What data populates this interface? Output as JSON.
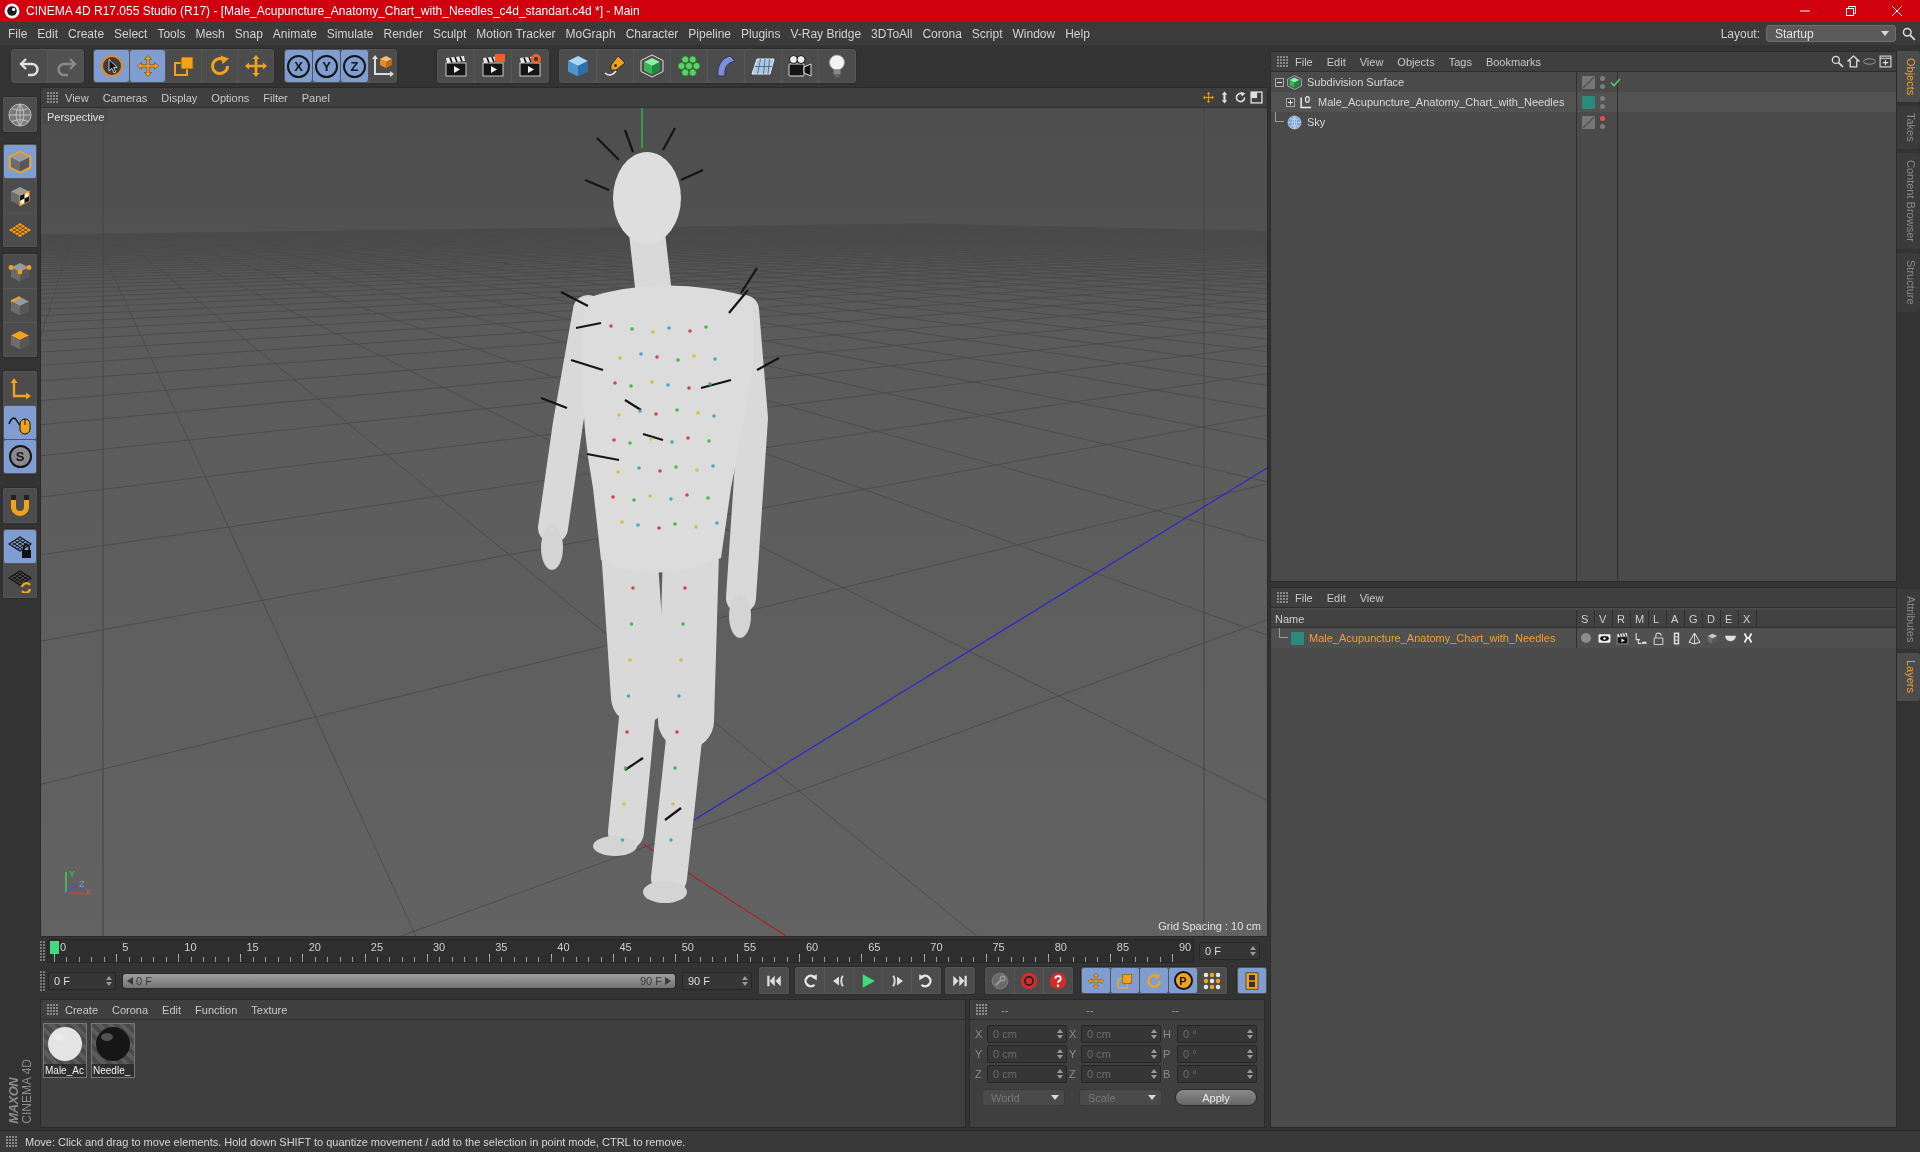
{
  "window": {
    "title": "CINEMA 4D R17.055 Studio (R17) - [Male_Acupuncture_Anatomy_Chart_with_Needles_c4d_standart.c4d *] - Main"
  },
  "menu_bar": [
    "File",
    "Edit",
    "Create",
    "Select",
    "Tools",
    "Mesh",
    "Snap",
    "Animate",
    "Simulate",
    "Render",
    "Sculpt",
    "Motion Tracker",
    "MoGraph",
    "Character",
    "Pipeline",
    "Plugins",
    "V-Ray Bridge",
    "3DToAll",
    "Corona",
    "Script",
    "Window",
    "Help"
  ],
  "layout": {
    "label": "Layout:",
    "value": "Startup"
  },
  "history": [
    {
      "disabled": false
    },
    {
      "disabled": true
    }
  ],
  "tools": [
    {
      "selected": true
    },
    {
      "selected": true
    },
    {
      "selected": false
    },
    {
      "selected": false
    },
    {
      "selected": false
    }
  ],
  "axis_locks": [
    {
      "label": "X",
      "selected": true
    },
    {
      "label": "Y",
      "selected": true
    },
    {
      "label": "Z",
      "selected": true
    }
  ],
  "modes": [
    [
      {
        "selected": false
      }
    ],
    [
      {
        "selected": true
      },
      {
        "selected": false
      },
      {
        "selected": false
      }
    ],
    [
      {
        "selected": false
      },
      {
        "selected": false
      },
      {
        "selected": false
      }
    ],
    [
      {
        "selected": false
      },
      {
        "selected": true
      },
      {
        "label": "S",
        "selected": true
      }
    ],
    [
      {
        "selected": false
      }
    ],
    [
      {
        "selected": true
      },
      {
        "selected": false
      }
    ]
  ],
  "logo": {
    "brand": "MAXON",
    "product": "CINEMA 4D"
  },
  "viewport": {
    "menu": [
      "View",
      "Cameras",
      "Display",
      "Options",
      "Filter",
      "Panel"
    ],
    "camera": "Perspective",
    "grid_spacing": "Grid Spacing : 10 cm",
    "gizmo_labels": [
      "Y",
      "Z",
      "X"
    ]
  },
  "timeline": {
    "ticks": [
      "0",
      "5",
      "10",
      "15",
      "20",
      "25",
      "30",
      "35",
      "40",
      "45",
      "50",
      "55",
      "60",
      "65",
      "70",
      "75",
      "80",
      "85",
      "90"
    ],
    "level": 0,
    "current_frame": "0 F"
  },
  "playback": {
    "start": "0 F",
    "range": {
      "start": "0 F",
      "end": "90 F",
      "level": 1
    },
    "end": "90 F",
    "key_filters": [
      {
        "selected": true
      },
      {
        "selected": true
      },
      {
        "selected": true
      },
      {
        "label": "P",
        "selected": true
      },
      {
        "selected": false
      }
    ],
    "timeline_view": {
      "selected": true
    }
  },
  "materials": {
    "menu": [
      "Create",
      "Corona",
      "Edit",
      "Function",
      "Texture"
    ],
    "items": [
      {
        "name": "Male_Ac",
        "color": "#e4e4e4"
      },
      {
        "name": "Needle_",
        "color": "#161616"
      }
    ]
  },
  "coordinates": {
    "disabled": true,
    "headers": [
      "--",
      "--",
      "--"
    ],
    "rows": [
      {
        "position_axis": "X",
        "position": "0 cm",
        "size_axis": "X",
        "size": "0 cm",
        "rotation_axis": "H",
        "rotation": "0 °"
      },
      {
        "position_axis": "Y",
        "position": "0 cm",
        "size_axis": "Y",
        "size": "0 cm",
        "rotation_axis": "P",
        "rotation": "0 °"
      },
      {
        "position_axis": "Z",
        "position": "0 cm",
        "size_axis": "Z",
        "size": "0 cm",
        "rotation_axis": "B",
        "rotation": "0 °"
      }
    ],
    "dropdowns": [
      "World",
      "Scale"
    ],
    "apply": "Apply"
  },
  "objects": {
    "menu": [
      "File",
      "Edit",
      "View",
      "Objects",
      "Tags",
      "Bookmarks"
    ],
    "items": [
      {
        "name": "Subdivision Surface",
        "kind": "subdivision",
        "expanded": true,
        "selected": false,
        "enabled": true,
        "visibility": [
          {
            "color": "#7c7c7c"
          },
          {
            "color": "#7c7c7c"
          }
        ],
        "children": [
          {
            "name": "Male_Acupuncture_Anatomy_Chart_with_Needles",
            "kind": "null",
            "expanded": false,
            "selected": false,
            "color": "#2b8a7c",
            "visibility": [
              {
                "color": "#7c7c7c"
              },
              {
                "color": "#7c7c7c"
              }
            ]
          }
        ]
      },
      {
        "name": "Sky",
        "kind": "sky",
        "selected": false,
        "visibility": [
          {
            "color": "#e84c4c"
          },
          {
            "color": "#7c7c7c"
          }
        ]
      }
    ]
  },
  "layers": {
    "menu": [
      "File",
      "Edit",
      "View"
    ],
    "columns": [
      "Name",
      "S",
      "V",
      "R",
      "M",
      "L",
      "A",
      "G",
      "D",
      "E",
      "X"
    ],
    "rows": [
      {
        "name": "Male_Acupuncture_Anatomy_Chart_with_Needles",
        "color": "#2b8a7c",
        "selected": true
      }
    ]
  },
  "side_tabs": {
    "top": [
      {
        "label": "Objects",
        "selected": true
      },
      {
        "label": "Takes",
        "selected": false
      },
      {
        "label": "Content Browser",
        "selected": false
      },
      {
        "label": "Structure",
        "selected": false
      }
    ],
    "bottom": [
      {
        "label": "Attributes",
        "selected": false
      },
      {
        "label": "Layers",
        "selected": true
      }
    ]
  },
  "status_bar": "Move: Click and drag to move elements. Hold down SHIFT to quantize movement / add to the selection in point mode, CTRL to remove."
}
